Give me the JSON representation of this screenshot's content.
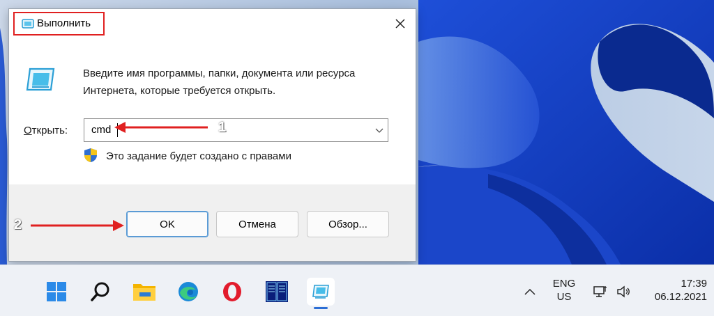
{
  "dialog": {
    "title": "Выполнить",
    "description": "Введите имя программы, папки, документа или ресурса Интернета, которые требуется открыть.",
    "open_label_prefix": "О",
    "open_label_rest": "ткрыть:",
    "input_value": "cmd",
    "admin_note": "Это задание будет создано с правами",
    "buttons": {
      "ok": "OK",
      "cancel": "Отмена",
      "browse": "Обзор..."
    }
  },
  "annotations": {
    "step1": "1",
    "step2": "2"
  },
  "taskbar": {
    "apps": [
      "start-icon",
      "search-icon",
      "file-explorer-icon",
      "edge-icon",
      "opera-icon",
      "far-manager-icon",
      "run-app-icon"
    ],
    "tray": {
      "lang_top": "ENG",
      "lang_bottom": "US",
      "time": "17:39",
      "date": "06.12.2021"
    }
  },
  "colors": {
    "accent": "#2c6ed5",
    "annotation_red": "#e02020",
    "ok_border": "#5b9bd5"
  }
}
